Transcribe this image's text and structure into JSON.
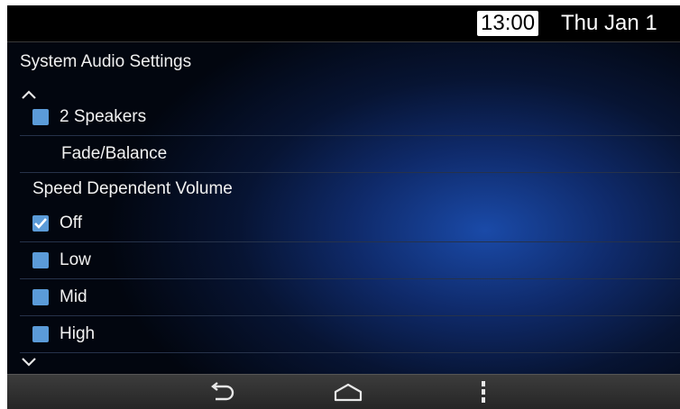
{
  "status_bar": {
    "time": "13:00",
    "date": "Thu Jan 1"
  },
  "title": "System Audio Settings",
  "items": [
    {
      "label": "2 Speakers",
      "type": "checkbox",
      "checked": false
    },
    {
      "label": "Fade/Balance",
      "type": "link"
    }
  ],
  "speed_dependent_volume": {
    "heading": "Speed Dependent Volume",
    "options": [
      {
        "label": "Off",
        "checked": true
      },
      {
        "label": "Low",
        "checked": false
      },
      {
        "label": "Mid",
        "checked": false
      },
      {
        "label": "High",
        "checked": false
      }
    ]
  },
  "nav_bar": {
    "icons": [
      "back-icon",
      "home-icon",
      "menu-icon"
    ]
  },
  "colors": {
    "checkbox": "#5b9bd8",
    "background_glow": "#1a4aa8",
    "status_bar": "#000000"
  }
}
